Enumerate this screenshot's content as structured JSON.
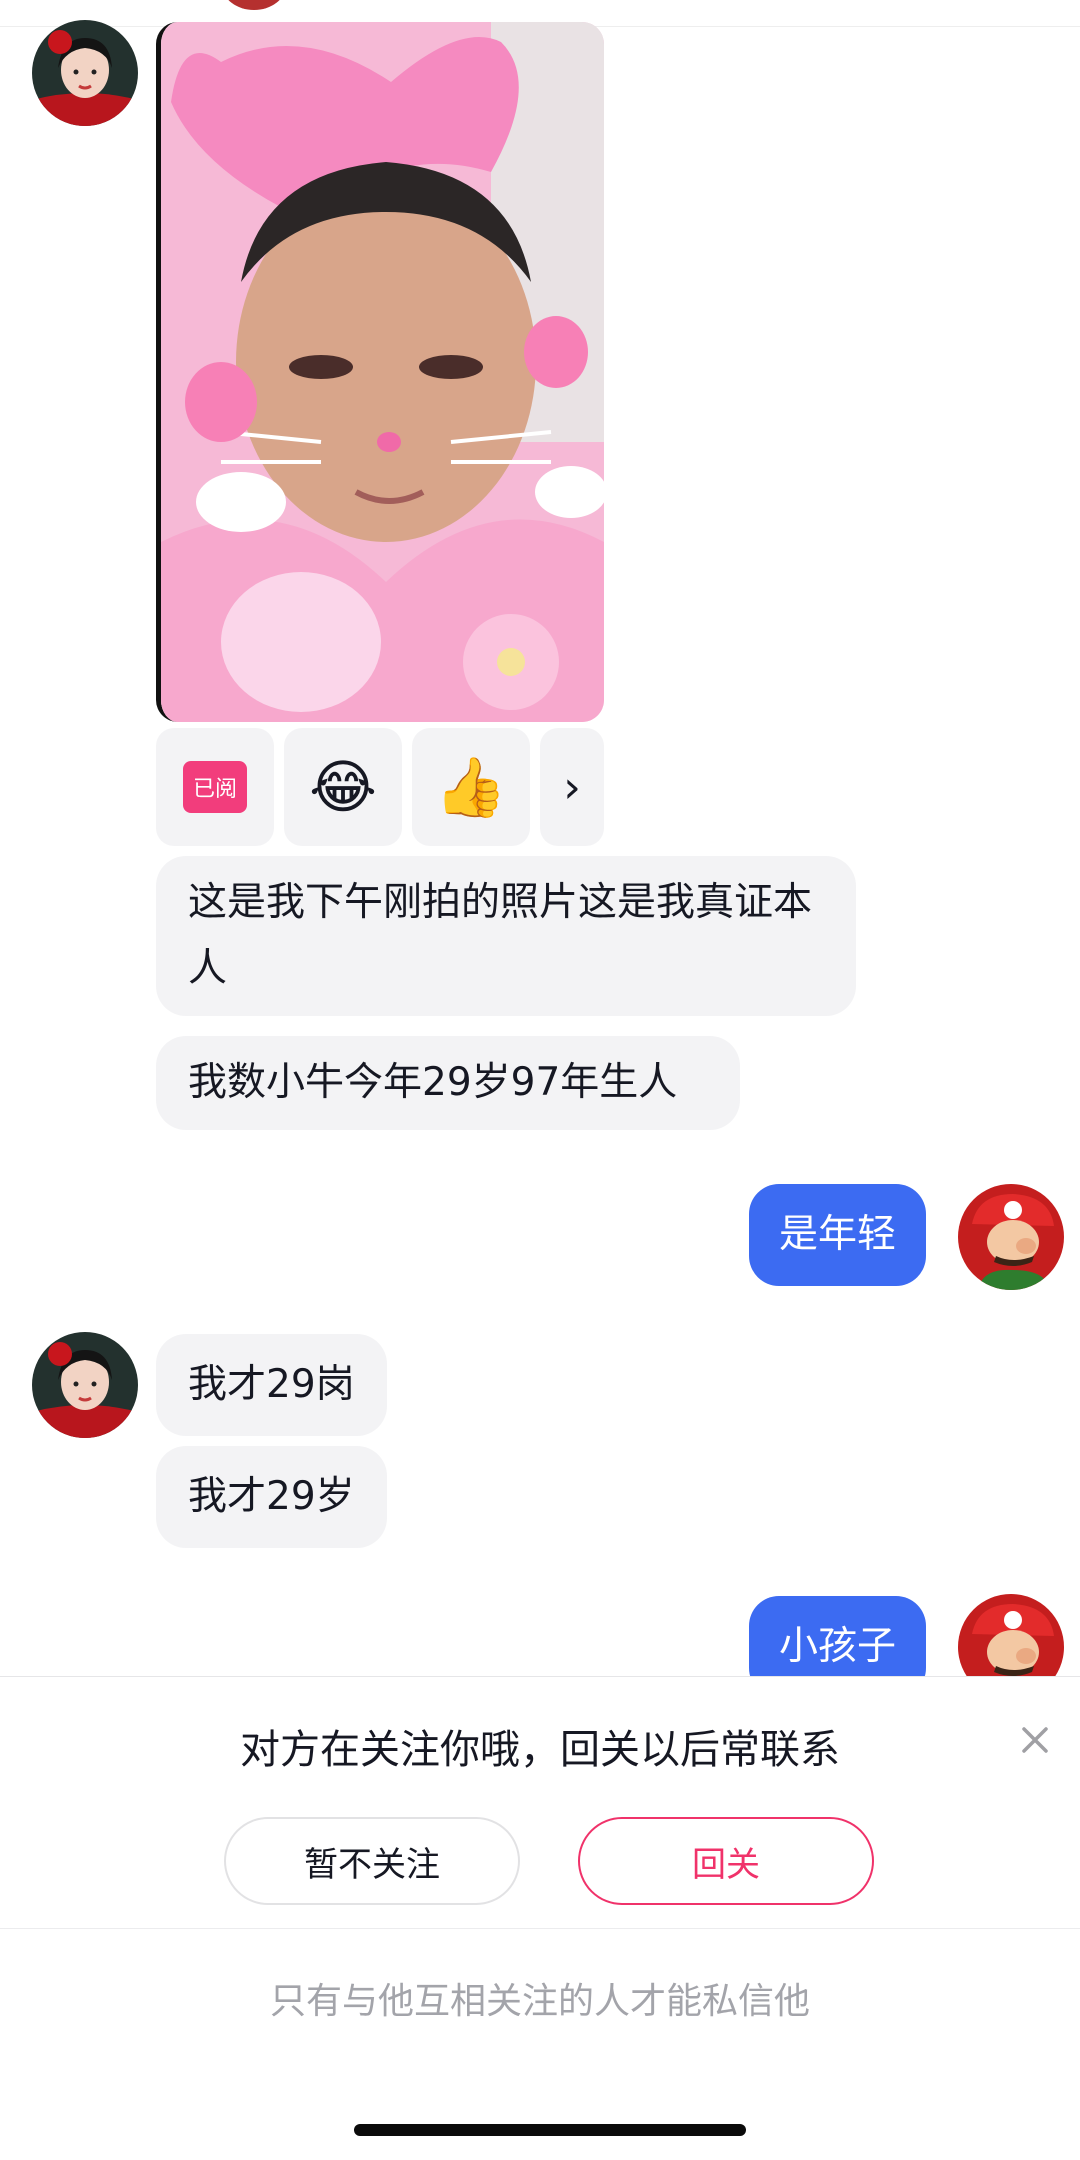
{
  "read_badge": "已阅",
  "reactions": {
    "laugh": "😂",
    "thumbs": "👍",
    "more": "›"
  },
  "messages": {
    "in1": "这是我下午刚拍的照片这是我真证本人",
    "in2": "我数小牛今年29岁97年生人",
    "out1": "是年轻",
    "in3": "我才29岗",
    "in4": "我才29岁",
    "out2": "小孩子"
  },
  "follow_prompt": {
    "text": "对方在关注你哦，回关以后常联系",
    "decline_label": "暂不关注",
    "accept_label": "回关"
  },
  "notice": "只有与他互相关注的人才能私信他",
  "colors": {
    "outgoing_bubble": "#3c6bf2",
    "accent": "#f0326a"
  }
}
